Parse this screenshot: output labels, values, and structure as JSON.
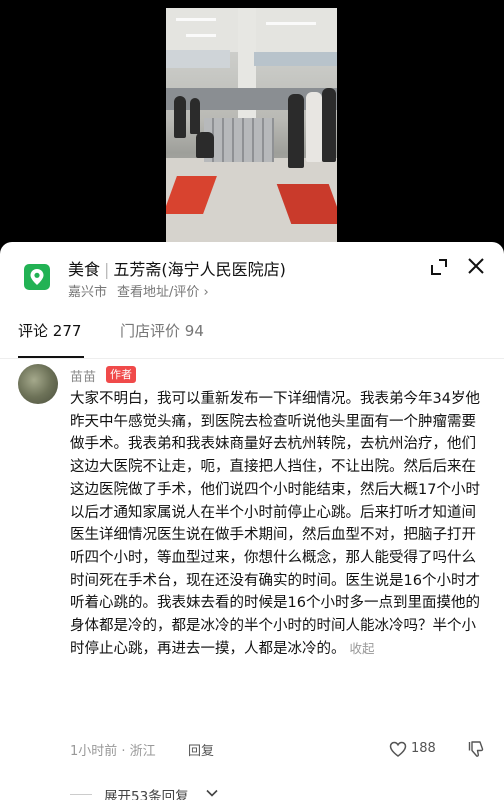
{
  "shop": {
    "category": "美食",
    "name": "五芳斋(海宁人民医院店)",
    "city": "嘉兴市",
    "address_link": "查看地址/评价",
    "address_chevron": "›"
  },
  "tabs": [
    {
      "label": "评论",
      "count": "277"
    },
    {
      "label": "门店评价",
      "count": "94"
    }
  ],
  "comment": {
    "author": "苗苗",
    "author_tag": "作者",
    "text": "大家不明白，我可以重新发布一下详细情况。我表弟今年34岁他昨天中午感觉头痛，到医院去检查听说他头里面有一个肿瘤需要做手术。我表弟和我表妹商量好去杭州转院，去杭州治疗，他们这边大医院不让走，呃，直接把人挡住，不让出院。然后后来在这边医院做了手术，他们说四个小时能结束，然后大概17个小时以后才通知家属说人在半个小时前停止心跳。后来打听才知道间医生详细情况医生说在做手术期间，然后血型不对，把脑子打开听四个小时，等血型过来，你想什么概念，那人能受得了吗什么时间死在手术台，现在还没有确实的时间。医生说是16个小时才听着心跳的。我表妹去看的时候是16个小时多一点到里面摸他的身体都是冷的，都是冰冷的半个小时的时间人能冰冷吗？半个小时停止心跳，再进去一摸，人都是冰冷的。",
    "collapse_label": "收起",
    "time_location": "1小时前 · 浙江",
    "reply_label": "回复",
    "likes": "188"
  },
  "expand_replies": "展开53条回复",
  "colors": {
    "pin_green": "#22b254",
    "author_tag_red": "#f04a4a"
  },
  "icons": [
    "map-pin-icon",
    "expand-icon",
    "close-icon",
    "heart-icon",
    "dislike-icon",
    "chevron-down-icon"
  ]
}
